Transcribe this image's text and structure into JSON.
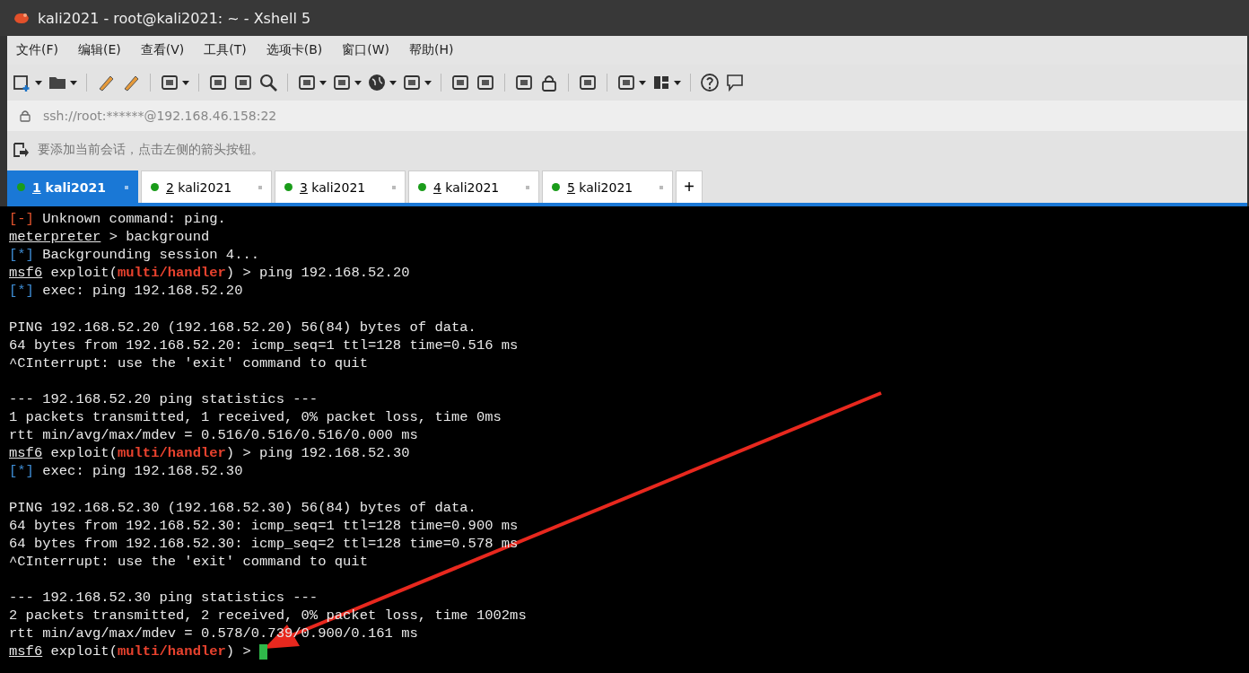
{
  "window": {
    "title": "kali2021 - root@kali2021: ~ - Xshell 5"
  },
  "menu": [
    "文件(F)",
    "编辑(E)",
    "查看(V)",
    "工具(T)",
    "选项卡(B)",
    "窗口(W)",
    "帮助(H)"
  ],
  "address": {
    "value": "ssh://root:******@192.168.46.158:22"
  },
  "session_hint": "要添加当前会话，点击左侧的箭头按钮。",
  "tabs": [
    {
      "number": "1",
      "label": "kali2021",
      "selected": true,
      "color": "#1a9c1a"
    },
    {
      "number": "2",
      "label": "kali2021",
      "selected": false,
      "color": "#1a9c1a"
    },
    {
      "number": "3",
      "label": "kali2021",
      "selected": false,
      "color": "#1a9c1a"
    },
    {
      "number": "4",
      "label": "kali2021",
      "selected": false,
      "color": "#1a9c1a"
    },
    {
      "number": "5",
      "label": "kali2021",
      "selected": false,
      "color": "#1a9c1a"
    }
  ],
  "new_tab": "+",
  "terminal": {
    "cursor_visible": true,
    "lines": [
      {
        "segments": [
          {
            "kind": "error",
            "text": "[-]"
          },
          {
            "kind": "plain",
            "text": " Unknown command: ping."
          }
        ]
      },
      {
        "segments": [
          {
            "kind": "prompt",
            "text": "meterpreter"
          },
          {
            "kind": "plain",
            "text": " > background"
          }
        ]
      },
      {
        "segments": [
          {
            "kind": "info",
            "text": "[*]"
          },
          {
            "kind": "plain",
            "text": " Backgrounding session 4..."
          }
        ]
      },
      {
        "segments": [
          {
            "kind": "prompt",
            "text": "msf6"
          },
          {
            "kind": "plain",
            "text": " exploit("
          },
          {
            "kind": "module",
            "text": "multi/handler"
          },
          {
            "kind": "plain",
            "text": ") > ping 192.168.52.20"
          }
        ]
      },
      {
        "segments": [
          {
            "kind": "info",
            "text": "[*]"
          },
          {
            "kind": "plain",
            "text": " exec: ping 192.168.52.20"
          }
        ]
      },
      {
        "blank_before": true,
        "segments": [
          {
            "kind": "plain",
            "text": "PING 192.168.52.20 (192.168.52.20) 56(84) bytes of data."
          }
        ]
      },
      {
        "segments": [
          {
            "kind": "plain",
            "text": "64 bytes from 192.168.52.20: icmp_seq=1 ttl=128 time=0.516 ms"
          }
        ]
      },
      {
        "segments": [
          {
            "kind": "plain",
            "text": "^CInterrupt: use the 'exit' command to quit"
          }
        ]
      },
      {
        "blank_before": true,
        "segments": [
          {
            "kind": "plain",
            "text": "--- 192.168.52.20 ping statistics ---"
          }
        ]
      },
      {
        "segments": [
          {
            "kind": "plain",
            "text": "1 packets transmitted, 1 received, 0% packet loss, time 0ms"
          }
        ]
      },
      {
        "segments": [
          {
            "kind": "plain",
            "text": "rtt min/avg/max/mdev = 0.516/0.516/0.516/0.000 ms"
          }
        ]
      },
      {
        "segments": [
          {
            "kind": "prompt",
            "text": "msf6"
          },
          {
            "kind": "plain",
            "text": " exploit("
          },
          {
            "kind": "module",
            "text": "multi/handler"
          },
          {
            "kind": "plain",
            "text": ") > ping 192.168.52.30"
          }
        ]
      },
      {
        "segments": [
          {
            "kind": "info",
            "text": "[*]"
          },
          {
            "kind": "plain",
            "text": " exec: ping 192.168.52.30"
          }
        ]
      },
      {
        "blank_before": true,
        "segments": [
          {
            "kind": "plain",
            "text": "PING 192.168.52.30 (192.168.52.30) 56(84) bytes of data."
          }
        ]
      },
      {
        "segments": [
          {
            "kind": "plain",
            "text": "64 bytes from 192.168.52.30: icmp_seq=1 ttl=128 time=0.900 ms"
          }
        ]
      },
      {
        "segments": [
          {
            "kind": "plain",
            "text": "64 bytes from 192.168.52.30: icmp_seq=2 ttl=128 time=0.578 ms"
          }
        ]
      },
      {
        "segments": [
          {
            "kind": "plain",
            "text": "^CInterrupt: use the 'exit' command to quit"
          }
        ]
      },
      {
        "blank_before": true,
        "segments": [
          {
            "kind": "plain",
            "text": "--- 192.168.52.30 ping statistics ---"
          }
        ]
      },
      {
        "segments": [
          {
            "kind": "plain",
            "text": "2 packets transmitted, 2 received, 0% packet loss, time 1002ms"
          }
        ]
      },
      {
        "segments": [
          {
            "kind": "plain",
            "text": "rtt min/avg/max/mdev = 0.578/0.739/0.900/0.161 ms"
          }
        ]
      },
      {
        "segments": [
          {
            "kind": "prompt",
            "text": "msf6"
          },
          {
            "kind": "plain",
            "text": " exploit("
          },
          {
            "kind": "module",
            "text": "multi/handler"
          },
          {
            "kind": "plain",
            "text": ") > "
          }
        ]
      }
    ]
  }
}
